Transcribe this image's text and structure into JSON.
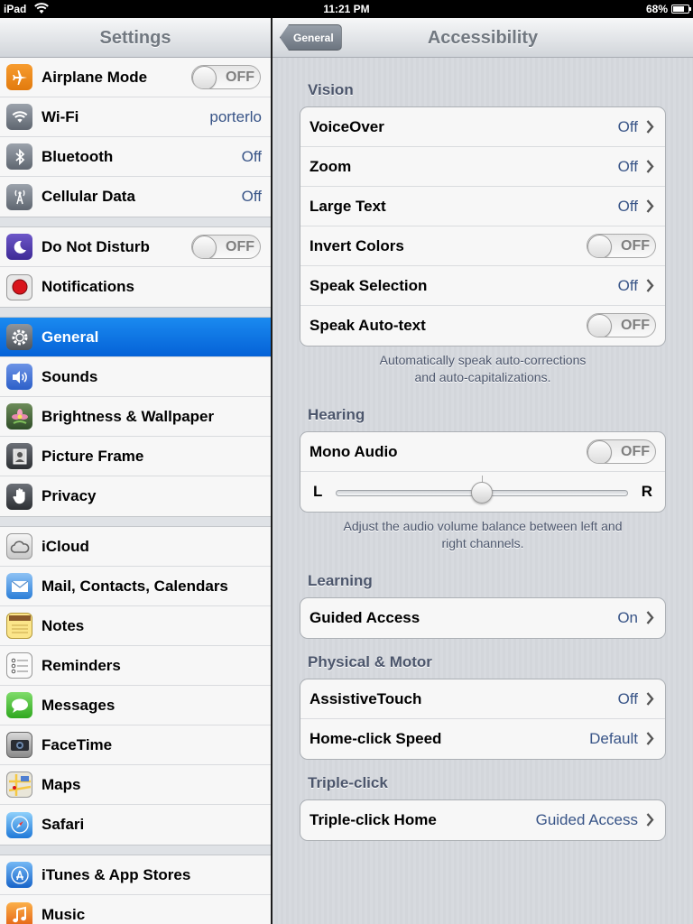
{
  "status_bar": {
    "device": "iPad",
    "time": "11:21 PM",
    "battery": "68%"
  },
  "master": {
    "title": "Settings",
    "groups": [
      {
        "items": [
          {
            "label": "Airplane Mode",
            "icon": "airplane-icon",
            "toggle": "OFF"
          },
          {
            "label": "Wi-Fi",
            "icon": "wifi-icon",
            "value": "porterlo"
          },
          {
            "label": "Bluetooth",
            "icon": "bluetooth-icon",
            "value": "Off"
          },
          {
            "label": "Cellular Data",
            "icon": "cellular-icon",
            "value": "Off"
          }
        ]
      },
      {
        "items": [
          {
            "label": "Do Not Disturb",
            "icon": "moon-icon",
            "toggle": "OFF"
          },
          {
            "label": "Notifications",
            "icon": "notifications-icon"
          }
        ]
      },
      {
        "items": [
          {
            "label": "General",
            "icon": "gear-icon",
            "selected": true
          },
          {
            "label": "Sounds",
            "icon": "speaker-icon"
          },
          {
            "label": "Brightness & Wallpaper",
            "icon": "flower-icon"
          },
          {
            "label": "Picture Frame",
            "icon": "picture-frame-icon"
          },
          {
            "label": "Privacy",
            "icon": "hand-icon"
          }
        ]
      },
      {
        "items": [
          {
            "label": "iCloud",
            "icon": "cloud-icon"
          },
          {
            "label": "Mail, Contacts, Calendars",
            "icon": "mail-icon"
          },
          {
            "label": "Notes",
            "icon": "notes-icon"
          },
          {
            "label": "Reminders",
            "icon": "reminders-icon"
          },
          {
            "label": "Messages",
            "icon": "messages-icon"
          },
          {
            "label": "FaceTime",
            "icon": "facetime-icon"
          },
          {
            "label": "Maps",
            "icon": "maps-icon"
          },
          {
            "label": "Safari",
            "icon": "safari-compass-icon"
          }
        ]
      },
      {
        "items": [
          {
            "label": "iTunes & App Stores",
            "icon": "app-store-icon"
          },
          {
            "label": "Music",
            "icon": "music-icon"
          }
        ]
      }
    ]
  },
  "detail": {
    "back_label": "General",
    "title": "Accessibility",
    "vision": {
      "header": "Vision",
      "voiceover": {
        "label": "VoiceOver",
        "value": "Off"
      },
      "zoom": {
        "label": "Zoom",
        "value": "Off"
      },
      "large_text": {
        "label": "Large Text",
        "value": "Off"
      },
      "invert_colors": {
        "label": "Invert Colors",
        "toggle": "OFF"
      },
      "speak_selection": {
        "label": "Speak Selection",
        "value": "Off"
      },
      "speak_autotext": {
        "label": "Speak Auto-text",
        "toggle": "OFF"
      },
      "footer_line1": "Automatically speak auto-corrections",
      "footer_line2": "and auto-capitalizations."
    },
    "hearing": {
      "header": "Hearing",
      "mono_audio": {
        "label": "Mono Audio",
        "toggle": "OFF"
      },
      "left_label": "L",
      "right_label": "R",
      "balance": 0.5,
      "footer_line1": "Adjust the audio volume balance between left and",
      "footer_line2": "right channels."
    },
    "learning": {
      "header": "Learning",
      "guided_access": {
        "label": "Guided Access",
        "value": "On"
      }
    },
    "physical_motor": {
      "header": "Physical & Motor",
      "assistive_touch": {
        "label": "AssistiveTouch",
        "value": "Off"
      },
      "home_click_speed": {
        "label": "Home-click Speed",
        "value": "Default"
      }
    },
    "triple_click": {
      "header": "Triple-click",
      "triple_click_home": {
        "label": "Triple-click Home",
        "value": "Guided Access"
      }
    }
  }
}
